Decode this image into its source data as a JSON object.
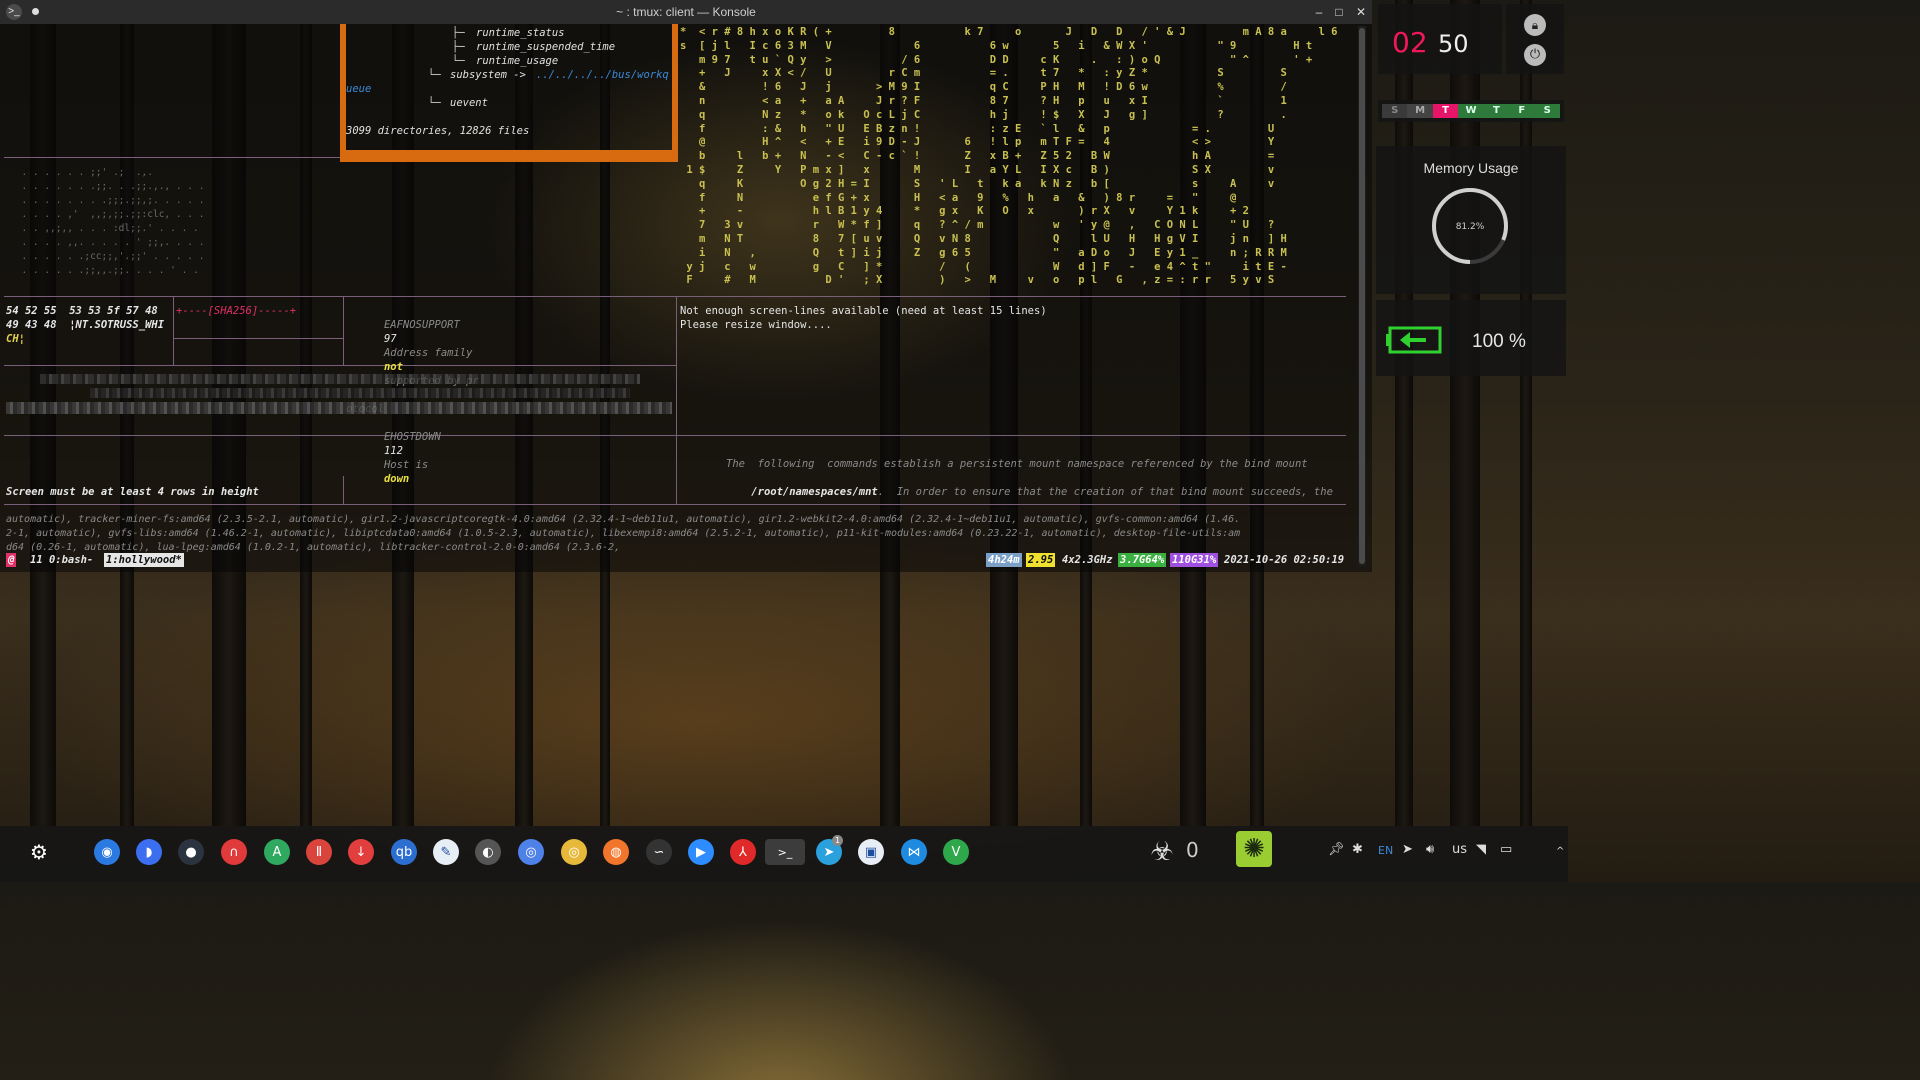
{
  "window": {
    "title": "~ : tmux: client — Konsole",
    "minimize": "–",
    "maximize": "□",
    "close": "✕"
  },
  "tree": {
    "lines": [
      "runtime_status",
      "runtime_suspended_time",
      "runtime_usage"
    ],
    "subsystem": "subsystem ->",
    "subsystem_link": "../../../../bus/workq",
    "queue_tail": "ueue",
    "uevent": "uevent",
    "summary": "3099 directories, 12826 files"
  },
  "ascii_art": [
    "  . . . . . . ;;' .;  .,.         ",
    "  . . . . . . .;;. . .;;.,., . . .",
    "  . . . . . . . .;;;.;;,;. . . . .",
    "  . . . . ,'  ,,;,;;.;;:clc, . . .",
    "  . . ,,;,, . . . :dl;;.' . . . . ",
    "  . . . . ,,. . . . . ' ;;,. . . .",
    "  . . . . . .;cc;;,'.;;' . . . . .",
    "  . . . . . .;;,,.;;. . . . ' . . "
  ],
  "hex_panel": {
    "row1": "54 52 55  53 53 5f 57 48",
    "row2": "49 43 48  ¦NT.SOTRUSS_WHI",
    "row3": "CH¦",
    "sha": "+----[SHA256]-----+"
  },
  "errno_panel": {
    "line1_name": "EAFNOSUPPORT",
    "line1_num": "97",
    "line1_text_a": "Address family",
    "line1_hl": "not",
    "line1_text_b": "supported by pr",
    "line2": "otocol",
    "line3_name": "EHOSTDOWN",
    "line3_num": "112",
    "line3_text": "Host is",
    "line3_hl": "down"
  },
  "resize_msg": {
    "line1": "Not enough screen-lines available (need at least 15 lines)",
    "line2": "Please resize window...."
  },
  "screen_msg": "Screen must be at least 4 rows in height",
  "namespace_msg": {
    "line1": "The  following  commands establish a persistent mount namespace referenced by the bind mount",
    "line2_path": "/root/namespaces/mnt",
    "line2_rest": ".  In order to ensure that the creation of that bind mount succeeds, the"
  },
  "apt_log": [
    "automatic), tracker-miner-fs:amd64 (2.3.5-2.1, automatic), gir1.2-javascriptcoregtk-4.0:amd64 (2.32.4-1~deb11u1, automatic), gir1.2-webkit2-4.0:amd64 (2.32.4-1~deb11u1, automatic), gvfs-common:amd64 (1.46.",
    "2-1, automatic), gvfs-libs:amd64 (1.46.2-1, automatic), libiptcdata0:amd64 (1.0.5-2.3, automatic), libexempi8:amd64 (2.5.2-1, automatic), p11-kit-modules:amd64 (0.23.22-1, automatic), desktop-file-utils:am",
    "d64 (0.26-1, automatic), lua-lpeg:amd64 (1.0.2-1, automatic), libtracker-control-2.0-0:amd64 (2.3.6-2,"
  ],
  "matrix_rows": [
    "*  < r # 8 h x o K R ( +         8           k 7     o       J   D   D   / ' & J         m A 8 a     l 6",
    "s  [ j l   I c 6 3 M   V             6           6 w       5   i   & W X '           \" 9         H t",
    "   m 9 7   t u ` Q y   >           / 6           D D     c K     .   : ) o Q           \" ^       ' +",
    "   +   J     x X < /   U         r C m           = .     t 7   *   : y Z *           S         S",
    "   &         ! 6   J   j       > M 9 I           q C     P H   M   ! D 6 w           %         /",
    "   n         < a   +   a A     J r ? F           8 7     ? H   p   u   x I           `         1",
    "   q         N z   *   o k   O c L j C           h j     ! $   X   J   g ]           ?         .",
    "   f         : &   h   \" U   E B z n !           : z E   ` l   &   p             = .         U",
    "   @         H ^   <   + E   i 9 D - J       6   ! l p   m T F =   4             < >         Y",
    "   b     l   b +   N   - <   C - c ` !       Z   x B +   Z 5 2   B W             h A         =",
    " 1 $     Z     Y   P m x ]   x       M       I   a Y L   I X c   B )             S X         v",
    "   q     K         O g 2 H = I       S   ' L   t   k a   k N z   b [             s     A     v",
    "   f     N           e f G + x       H   < a   9   %   h   a   &   ) 8 r     =   \"     @",
    "   +     -           h l B 1 y 4     *   g x   K   O   x       ) r X   v     Y 1 k     + 2",
    "   7   3 v           r   W * f ]     q   ? ^ / m           w   ' y @   ,   C O N L     \" U   ?",
    "   m   N T           8   7 [ u v     Q   v N 8             Q     l U   H   H g V I     j n   ] H",
    "   i   N   ,         Q   t ] i j     Z   g 6 5             \"   a D o   J   E y 1 _     n ; R R M",
    " y j   c   w         g   C   ] *         /   (             W   d ] F   -   e 4 ^ t \"     i t E -",
    " F     #   M           D '   ; X         )   >   M     v   o   p l   G   , z = : r r   5 y v S"
  ],
  "statusbar": {
    "marker": "@",
    "windows": "11 0:bash-",
    "active": "1:hollywood*",
    "uptime": "4h24m",
    "load": "2.95",
    "cpu": "4x2.3GHz",
    "mem": "3.7G64%",
    "disk": "110G31%",
    "datetime": "2021-10-26 02:50:19"
  },
  "clock": {
    "hours": "02",
    "minutes": "50"
  },
  "weekdays": [
    "S",
    "M",
    "T",
    "W",
    "T",
    "F",
    "S"
  ],
  "memory": {
    "title": "Memory Usage",
    "value": "81.2%",
    "fraction": 0.812
  },
  "battery": {
    "percent": "100 %"
  },
  "taskbar": {
    "icons": [
      {
        "name": "kde-launcher-icon",
        "color": "#3a3a3a",
        "glyph": "⚙"
      },
      {
        "name": "finder-icon",
        "color": "#2a7ae2",
        "glyph": "◉"
      },
      {
        "name": "fish-icon",
        "color": "#3b6ff0",
        "glyph": "◗"
      },
      {
        "name": "moon-icon",
        "color": "#2c3340",
        "glyph": "●"
      },
      {
        "name": "headphones-icon",
        "color": "#e03a3a",
        "glyph": "∩"
      },
      {
        "name": "inkscape-icon",
        "color": "#2fa860",
        "glyph": "A"
      },
      {
        "name": "pdf-tool-icon",
        "color": "#d9443c",
        "glyph": "Ⅱ"
      },
      {
        "name": "download-icon",
        "color": "#e23e3e",
        "glyph": "↓"
      },
      {
        "name": "qbittorrent-icon",
        "color": "#2d6fd1",
        "glyph": "qb"
      },
      {
        "name": "feather-icon",
        "color": "#e8eef5",
        "glyph": "✎"
      },
      {
        "name": "steam-icon",
        "color": "#555",
        "glyph": "◐"
      },
      {
        "name": "chromium-icon",
        "color": "#4f82e8",
        "glyph": "◎"
      },
      {
        "name": "chrome-icon",
        "color": "#e7b93a",
        "glyph": "◎"
      },
      {
        "name": "firefox-icon",
        "color": "#f1752b",
        "glyph": "◍"
      },
      {
        "name": "wire-icon",
        "color": "#333",
        "glyph": "∽"
      },
      {
        "name": "zoom-icon",
        "color": "#2d8cff",
        "glyph": "▶"
      },
      {
        "name": "acrobat-icon",
        "color": "#e02a2a",
        "glyph": "⅄"
      },
      {
        "name": "konsole-icon",
        "color": "#444",
        "glyph": ">_"
      },
      {
        "name": "telegram-icon",
        "color": "#2aa0dc",
        "glyph": "➤"
      },
      {
        "name": "virtualbox-icon",
        "color": "#e8eef5",
        "glyph": "▣"
      },
      {
        "name": "vscode-icon",
        "color": "#1f8be0",
        "glyph": "⋈"
      },
      {
        "name": "vim-icon",
        "color": "#2ea84a",
        "glyph": "V"
      }
    ],
    "hazard_count": "0",
    "telegram_badge": "1",
    "tray": {
      "lang": "EN",
      "kb": "us"
    }
  }
}
